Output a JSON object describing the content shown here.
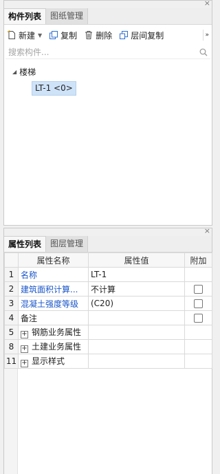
{
  "top_panel": {
    "close": "×",
    "tabs": [
      {
        "label": "构件列表",
        "active": true
      },
      {
        "label": "图纸管理",
        "active": false
      }
    ],
    "toolbar": {
      "new_label": "新建",
      "copy_label": "复制",
      "delete_label": "删除",
      "floor_copy_label": "层间复制",
      "more": "»"
    },
    "search": {
      "placeholder": "搜索构件..."
    },
    "tree": {
      "node_label": "楼梯",
      "leaf_label": "LT-1 <0>"
    }
  },
  "bottom_panel": {
    "close": "×",
    "tabs": [
      {
        "label": "属性列表",
        "active": true
      },
      {
        "label": "图层管理",
        "active": false
      }
    ],
    "table": {
      "headers": {
        "name": "属性名称",
        "value": "属性值",
        "extra": "附加"
      },
      "rows": [
        {
          "num": "1",
          "name": "名称",
          "value": "LT-1"
        },
        {
          "num": "2",
          "name": "建筑面积计算...",
          "value": "不计算"
        },
        {
          "num": "3",
          "name": "混凝土强度等级",
          "value": "(C20)"
        },
        {
          "num": "4",
          "name": "备注",
          "value": ""
        },
        {
          "num": "5",
          "name": "钢筋业务属性",
          "value": ""
        },
        {
          "num": "8",
          "name": "土建业务属性",
          "value": ""
        },
        {
          "num": "11",
          "name": "显示样式",
          "value": ""
        }
      ],
      "expand_symbol": "+"
    }
  },
  "colors": {
    "blue_text": "#1a56c9",
    "selection": "#cfe3f8"
  }
}
